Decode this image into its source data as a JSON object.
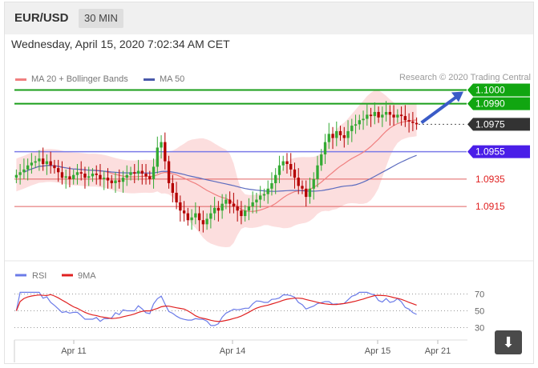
{
  "header": {
    "symbol": "EUR/USD",
    "timeframe": "30 MIN"
  },
  "datetime": "Wednesday, April 15, 2020 7:02:34 AM CET",
  "legend": {
    "ma20": "MA 20 + Bollinger Bands",
    "ma50": "MA 50"
  },
  "copyright": "Research © 2020 Trading Central",
  "colors": {
    "green": "#1a9e1a",
    "blue_level": "#5b5bf0",
    "red": "#e02020",
    "price": "#333333",
    "bollinger": "#fbd6d6",
    "ma20": "#f08080",
    "ma50": "#5b6bbf",
    "rsi": "#6b7be8",
    "rsi_ma": "#e02020",
    "candle_up": "#33aa33",
    "candle_down": "#b40000"
  },
  "chart_data": [
    {
      "type": "candlestick",
      "title": "",
      "ylim": [
        1.088,
        1.1005
      ],
      "x_ticks": [
        "Apr 11",
        "Apr 14",
        "Apr 15",
        "Apr 21"
      ],
      "levels": [
        {
          "value": 1.1,
          "label": "1.1000",
          "color": "#1a9e1a",
          "style": "target"
        },
        {
          "value": 1.099,
          "label": "1.0990",
          "color": "#1a9e1a",
          "style": "target"
        },
        {
          "value": 1.0975,
          "label": "1.0975",
          "color": "#333333",
          "style": "last"
        },
        {
          "value": 1.0955,
          "label": "1.0955",
          "color": "#4a1ee8",
          "style": "pivot"
        },
        {
          "value": 1.0935,
          "label": "1.0935",
          "color": "#e02020",
          "style": "support"
        },
        {
          "value": 1.0915,
          "label": "1.0915",
          "color": "#e02020",
          "style": "support"
        }
      ],
      "close": [
        1.0938,
        1.094,
        1.0942,
        1.0945,
        1.0947,
        1.0948,
        1.095,
        1.0946,
        1.0948,
        1.0945,
        1.0943,
        1.094,
        1.0936,
        1.0937,
        1.0935,
        1.0938,
        1.094,
        1.0939,
        1.0936,
        1.0937,
        1.0939,
        1.0938,
        1.0935,
        1.0936,
        1.0934,
        1.0932,
        1.0934,
        1.0933,
        1.0936,
        1.0938,
        1.094,
        1.0939,
        1.0941,
        1.0939,
        1.0937,
        1.0935,
        1.0944,
        1.0958,
        1.0962,
        1.0948,
        1.0932,
        1.0925,
        1.0918,
        1.0912,
        1.091,
        1.0905,
        1.0907,
        1.091,
        1.0905,
        1.0902,
        1.0906,
        1.091,
        1.0914,
        1.0912,
        1.0917,
        1.092,
        1.0917,
        1.0915,
        1.0912,
        1.0908,
        1.0912,
        1.0915,
        1.0918,
        1.092,
        1.0923,
        1.0924,
        1.0928,
        1.0932,
        1.0938,
        1.0945,
        1.0948,
        1.0946,
        1.0942,
        1.0936,
        1.093,
        1.0928,
        1.0922,
        1.0928,
        1.0935,
        1.0945,
        1.0953,
        1.0962,
        1.0968,
        1.0965,
        1.097,
        1.0967,
        1.0965,
        1.097,
        1.0974,
        1.0975,
        1.0978,
        1.0979,
        1.0982,
        1.0981,
        1.0984,
        1.098,
        1.0982,
        1.0984,
        1.0982,
        1.098,
        1.0982,
        1.0981,
        1.0978,
        1.0977,
        1.0976,
        1.0975
      ],
      "rsi": {
        "ylim": [
          20,
          80
        ],
        "ticks": [
          70,
          50,
          30
        ],
        "last": 50
      },
      "legend": [
        "RSI",
        "9MA"
      ]
    }
  ]
}
